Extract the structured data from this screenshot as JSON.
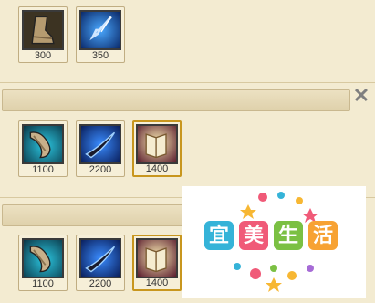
{
  "panels": {
    "first": {
      "items": [
        {
          "icon": "boots-icon",
          "price": "300"
        },
        {
          "icon": "dagger-icon",
          "price": "350"
        }
      ]
    },
    "second": {
      "close_label": "✕",
      "items": [
        {
          "icon": "boots-icon",
          "price": "1100"
        },
        {
          "icon": "blade-icon",
          "price": "2200"
        },
        {
          "icon": "tome-icon",
          "price": "1400"
        }
      ]
    },
    "third": {
      "items": [
        {
          "icon": "boots-icon",
          "price": "1100"
        },
        {
          "icon": "blade-icon",
          "price": "2200"
        },
        {
          "icon": "tome-icon",
          "price": "1400"
        }
      ]
    }
  },
  "watermark": {
    "chars": [
      "宜",
      "美",
      "生",
      "活"
    ]
  }
}
